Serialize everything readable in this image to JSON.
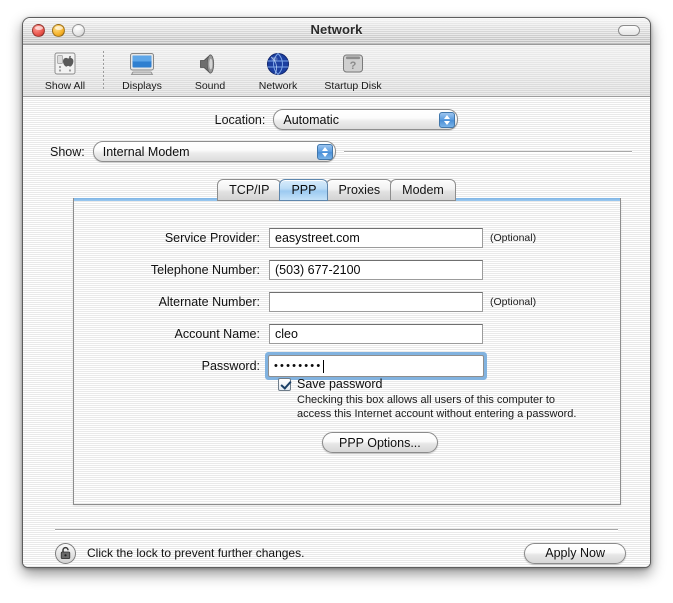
{
  "window": {
    "title": "Network",
    "traffic_lights": [
      "close-button",
      "minimize-button",
      "zoom-button"
    ]
  },
  "toolbar": {
    "items": [
      {
        "label": "Show All",
        "icon": "show-all-icon"
      },
      {
        "label": "Displays",
        "icon": "displays-icon"
      },
      {
        "label": "Sound",
        "icon": "sound-icon"
      },
      {
        "label": "Network",
        "icon": "network-globe-icon"
      },
      {
        "label": "Startup Disk",
        "icon": "startup-disk-icon"
      }
    ]
  },
  "location": {
    "label": "Location:",
    "value": "Automatic"
  },
  "show": {
    "label": "Show:",
    "value": "Internal Modem"
  },
  "tabs": [
    {
      "label": "TCP/IP",
      "selected": false
    },
    {
      "label": "PPP",
      "selected": true
    },
    {
      "label": "Proxies",
      "selected": false
    },
    {
      "label": "Modem",
      "selected": false
    }
  ],
  "form": {
    "service_provider": {
      "label": "Service Provider:",
      "value": "easystreet.com",
      "hint": "(Optional)"
    },
    "telephone_number": {
      "label": "Telephone Number:",
      "value": "(503) 677-2100",
      "hint": ""
    },
    "alternate_number": {
      "label": "Alternate Number:",
      "value": "",
      "hint": "(Optional)"
    },
    "account_name": {
      "label": "Account Name:",
      "value": "cleo",
      "hint": ""
    },
    "password": {
      "label": "Password:",
      "value": "••••••••",
      "hint": "",
      "focused": true
    }
  },
  "save_password": {
    "label": "Save password",
    "checked": true,
    "help_line1": "Checking this box allows all users of this computer to",
    "help_line2": "access this Internet account without entering a password."
  },
  "ppp_options": {
    "label": "PPP Options..."
  },
  "bottom": {
    "lock_icon": "open-padlock-icon",
    "note": "Click the lock to prevent further changes.",
    "apply_label": "Apply Now"
  },
  "colors": {
    "accent_blue": "#9ccaf1",
    "focus_ring": "#7bafde",
    "panel_rule": "#7fb4e4"
  }
}
